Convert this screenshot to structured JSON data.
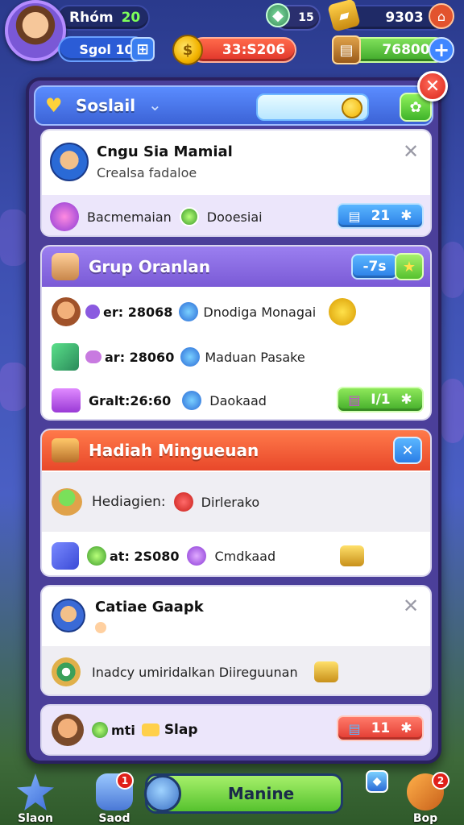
{
  "hud": {
    "player_name": "Rhóm",
    "player_level": "20",
    "stage": "Sgol 10",
    "coins": "33:S206",
    "gems": "15",
    "gold": "9303",
    "energy": "76800",
    "plus": "+",
    "icons": {
      "avatar": "player-avatar",
      "stage": "map-icon",
      "coin": "coin-icon",
      "gem": "gem-icon",
      "gold": "gold-bar-icon",
      "home": "home-icon",
      "energy": "chest-icon"
    }
  },
  "panel": {
    "title": "Soslail",
    "close": "✕",
    "gift": "✿"
  },
  "card1": {
    "title": "Cngu Sia Mamial",
    "subtitle": "Crealsa fadaloe",
    "close": "✕",
    "row_left": "Bacmemaian",
    "row_mid": "Dooesiai",
    "chip_value": "21",
    "chip_icon": "✱"
  },
  "card2": {
    "title": "Grup Oranlan",
    "head_chip": "-7s",
    "head_star": "★",
    "rows": [
      {
        "left": "er: 28068",
        "mid": "Dnodiga Monagai"
      },
      {
        "left": "ar: 28060",
        "mid": "Maduan Pasake"
      },
      {
        "left": "Gralt:26:60",
        "mid": "Daokaad",
        "chip": "I/1",
        "chip_icon": "✱"
      }
    ]
  },
  "card3": {
    "title": "Hadiah Mingueuan",
    "close": "✕",
    "rows": [
      {
        "left": "Hediagien:",
        "mid": "Dirlerako"
      },
      {
        "left": "at: 2S080",
        "mid": "Cmdkaad"
      }
    ]
  },
  "card4": {
    "title": "Catiae Gaapk",
    "close": "✕",
    "row": "Inadcy umiridalkan Diireguunan"
  },
  "card5": {
    "left": "mti",
    "mid": "Slap",
    "chip": "11",
    "chip_icon": "✱"
  },
  "nav": {
    "items": [
      {
        "label": "Slaon"
      },
      {
        "label": "Saod",
        "badge": "1"
      },
      {
        "label": "Bop",
        "badge": "2"
      }
    ],
    "main_button": "Manine"
  },
  "colors": {
    "accent_blue": "#3c63d6",
    "accent_green": "#56c22e",
    "accent_red": "#e23a30",
    "panel_purple": "#4b3f9a"
  }
}
